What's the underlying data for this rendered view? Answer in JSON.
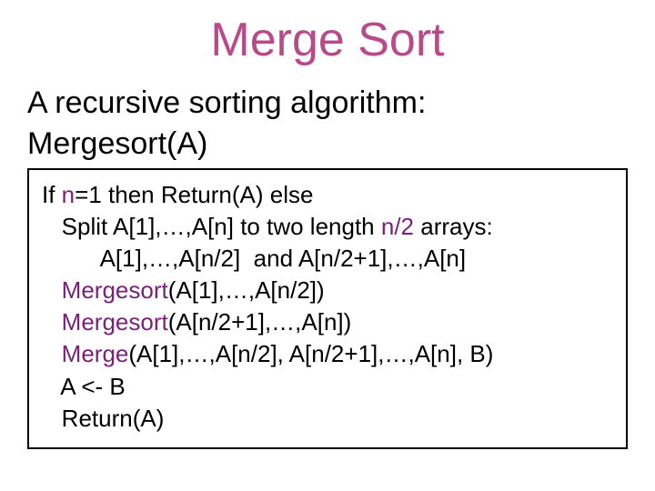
{
  "title": "Merge Sort",
  "subtitle_line1": "A recursive sorting algorithm:",
  "subtitle_line2": "Mergesort(A)",
  "code": {
    "l1_a": "If ",
    "l1_n": "n",
    "l1_b": "=1 then Return(A) else",
    "l2_a": "   Split A[1],…,A[n] to two length ",
    "l2_n": "n/2",
    "l2_b": " arrays:",
    "l3": "         A[1],…,A[n/2]  and A[n/2+1],…,A[n]",
    "l4_a": "   ",
    "l4_k": "Mergesort",
    "l4_b": "(A[1],…,A[n/2])",
    "l5_a": "   ",
    "l5_k": "Mergesort",
    "l5_b": "(A[n/2+1],…,A[n])",
    "l6_a": "   ",
    "l6_k": "Merge",
    "l6_b": "(A[1],…,A[n/2], A[n/2+1],…,A[n], B)",
    "l7": "   A <- B",
    "l8": "   Return(A)"
  }
}
